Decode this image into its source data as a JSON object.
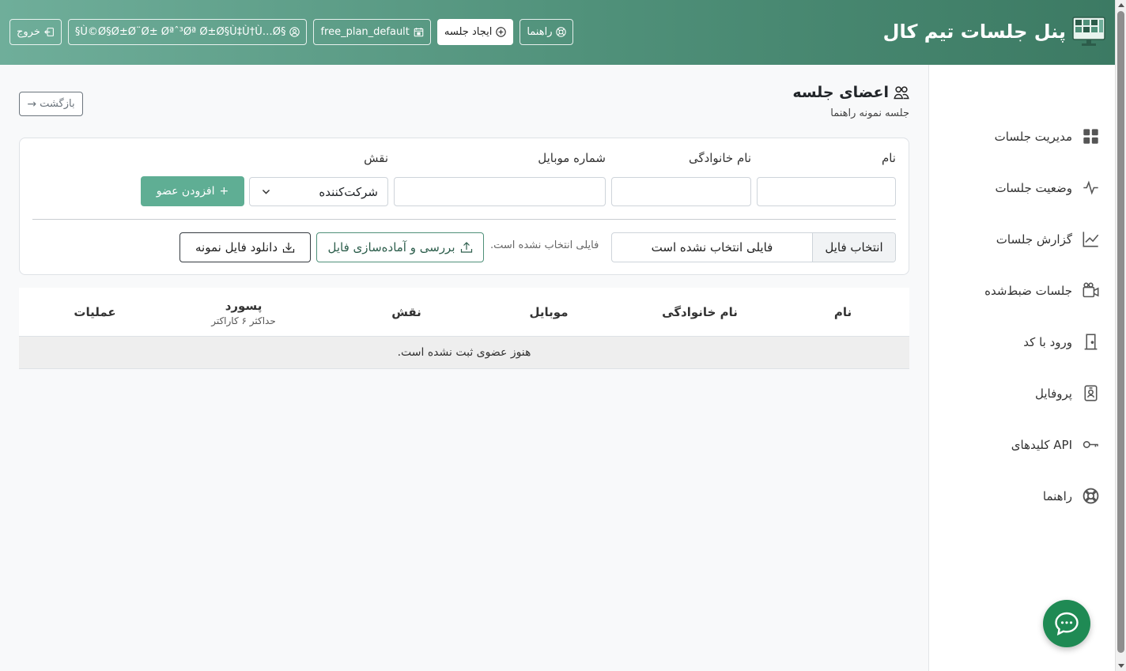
{
  "header": {
    "brand_title": "پنل جلسات تیم کال",
    "actions": {
      "logout": "خروج",
      "user": "§Ù©Ø§Ø±Ø¨Ø± Øªˆ³Øª Ø±Ø§Ù‡Ù†Ù…Ø§",
      "plan": "free_plan_default",
      "create_session": "ایجاد جلسه",
      "guide": "راهنما"
    }
  },
  "sidebar": {
    "items": [
      {
        "label": "مدیریت جلسات",
        "icon": "grid-icon"
      },
      {
        "label": "وضعیت جلسات",
        "icon": "activity-icon"
      },
      {
        "label": "گزارش جلسات",
        "icon": "chart-line-icon"
      },
      {
        "label": "جلسات ضبط‌شده",
        "icon": "camera-video-icon"
      },
      {
        "label": "ورود با کد",
        "icon": "door-icon"
      },
      {
        "label": "پروفایل",
        "icon": "person-badge-icon"
      },
      {
        "label": "کلیدهای API",
        "icon": "key-icon"
      },
      {
        "label": "راهنما",
        "icon": "life-ring-icon"
      }
    ]
  },
  "main": {
    "title": "اعضای جلسه",
    "subtitle": "جلسه نمونه راهنما",
    "back": "بازگشت",
    "form": {
      "labels": {
        "first_name": "نام",
        "last_name": "نام خانوادگی",
        "mobile": "شماره موبایل",
        "role": "نقش"
      },
      "values": {
        "first_name": "",
        "last_name": "",
        "mobile": ""
      },
      "role_selected": "شرکت‌کننده",
      "add_button": "افزودن عضو",
      "file_button": "انتخاب فایل",
      "file_text": "فایلی انتخاب نشده است",
      "file_note": "فایلی انتخاب نشده است.",
      "review_button": "بررسی و آماده‌سازی فایل",
      "download_button": "دانلود فایل نمونه"
    },
    "table": {
      "headers": {
        "first_name": "نام",
        "last_name": "نام خانوادگی",
        "mobile": "موبایل",
        "role": "نقش",
        "password": "پسورد",
        "password_hint": "حداکثر ۶ کاراکتر",
        "actions": "عملیات"
      },
      "empty": "هنوز عضوی ثبت نشده است."
    }
  },
  "colors": {
    "header_start": "#6fae9a",
    "header_end": "#3c7a63",
    "accent": "#5fae94",
    "chat": "#1f8a54"
  }
}
